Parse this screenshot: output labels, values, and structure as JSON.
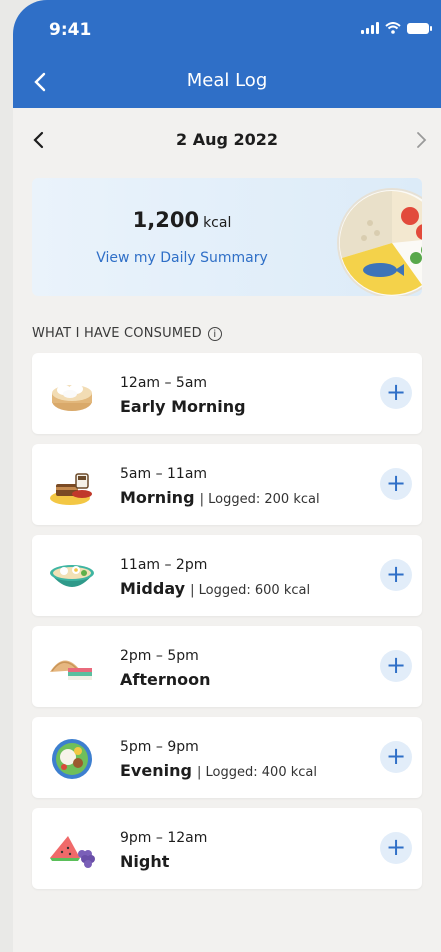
{
  "status": {
    "time": "9:41"
  },
  "header": {
    "title": "Meal Log"
  },
  "date": {
    "label": "2 Aug 2022"
  },
  "summary": {
    "kcal_value": "1,200",
    "kcal_unit": "kcal",
    "link": "View my Daily Summary"
  },
  "section": {
    "label": "WHAT I HAVE CONSUMED",
    "info_glyph": "i"
  },
  "meals": [
    {
      "time": "12am – 5am",
      "name": "Early Morning",
      "logged": ""
    },
    {
      "time": "5am – 11am",
      "name": "Morning",
      "logged": "| Logged: 200 kcal"
    },
    {
      "time": "11am – 2pm",
      "name": "Midday",
      "logged": "| Logged: 600 kcal"
    },
    {
      "time": "2pm – 5pm",
      "name": "Afternoon",
      "logged": ""
    },
    {
      "time": "5pm – 9pm",
      "name": "Evening",
      "logged": "| Logged: 400 kcal"
    },
    {
      "time": "9pm – 12am",
      "name": "Night",
      "logged": ""
    }
  ],
  "add_glyph": "+",
  "colors": {
    "accent": "#2f6fc7",
    "background": "#f2f1ef",
    "add_bg": "#e2edf9"
  },
  "icons": {
    "meal_icons": [
      "dumpling-basket-icon",
      "toast-coffee-icon",
      "noodle-bowl-icon",
      "curry-puff-icon",
      "nasi-lemak-icon",
      "fruit-icon"
    ]
  }
}
